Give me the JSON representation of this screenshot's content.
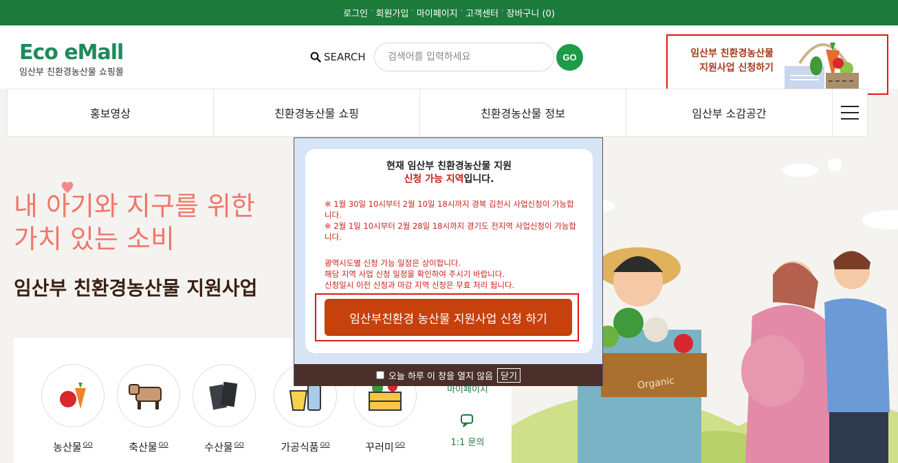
{
  "topbar": {
    "links": [
      "로그인",
      "회원가입",
      "마이페이지",
      "고객센터",
      "장바구니 (0)"
    ]
  },
  "header": {
    "brand": "Eco eMall",
    "brand_sub": "임산부 친환경농산물 쇼핑몰",
    "search_label": "SEARCH",
    "search_placeholder": "검색어를 입력하세요",
    "go_label": "GO",
    "apply_banner_line1": "임산부 친환경농산물",
    "apply_banner_line2": "지원사업 신청하기"
  },
  "nav": {
    "items": [
      "홍보영상",
      "친환경농산물 쇼핑",
      "친환경농산물 정보",
      "임산부 소감공간"
    ]
  },
  "hero": {
    "slogan_line1": "내 아기와 지구를 위한",
    "slogan_line2": "가치 있는 소비",
    "project_title": "임산부 친환경농산물 지원사업"
  },
  "categories": [
    {
      "label": "농산물",
      "go": "GO"
    },
    {
      "label": "축산물",
      "go": "GO"
    },
    {
      "label": "수산물",
      "go": "GO"
    },
    {
      "label": "가공식품",
      "go": "GO"
    },
    {
      "label": "꾸러미",
      "go": "GO"
    }
  ],
  "side_links": {
    "mypage": "마이페이지",
    "inquiry": "1:1 문의"
  },
  "popup": {
    "title_line1": "현재 임산부 친환경농산물 지원",
    "title_red": "신청 가능 지역",
    "title_rest": "입니다.",
    "note1": "※ 1월 30일 10시부터 2월 10일 18시까지 경북 김천시 사업신청이 가능합니다.",
    "note2": "※ 2월 1일 10시부터 2월 28일 18시까지 경기도 전지역 사업신청이 가능합니다.",
    "info1": "광역시도별 신청 가능 일정은 상이합니다.",
    "info2": "해당 지역 사업 신청 일정을 확인하여 주시기 바랍니다.",
    "info3": "신청일시 이전 신청과 마감 지역 신청은 무효 처리 됩니다.",
    "apply_button": "임산부친환경 농산물 지원사업 신청 하기",
    "dont_show": "오늘 하루 이 창을 열지 않음",
    "close": "닫기"
  },
  "illustration": {
    "crate_text": "Organic"
  },
  "colors": {
    "topbar": "#1c7a3a",
    "brand": "#1f8a5a",
    "slogan": "#f0766a",
    "apply_button": "#c6410c",
    "highlight_border": "#e2141b"
  }
}
